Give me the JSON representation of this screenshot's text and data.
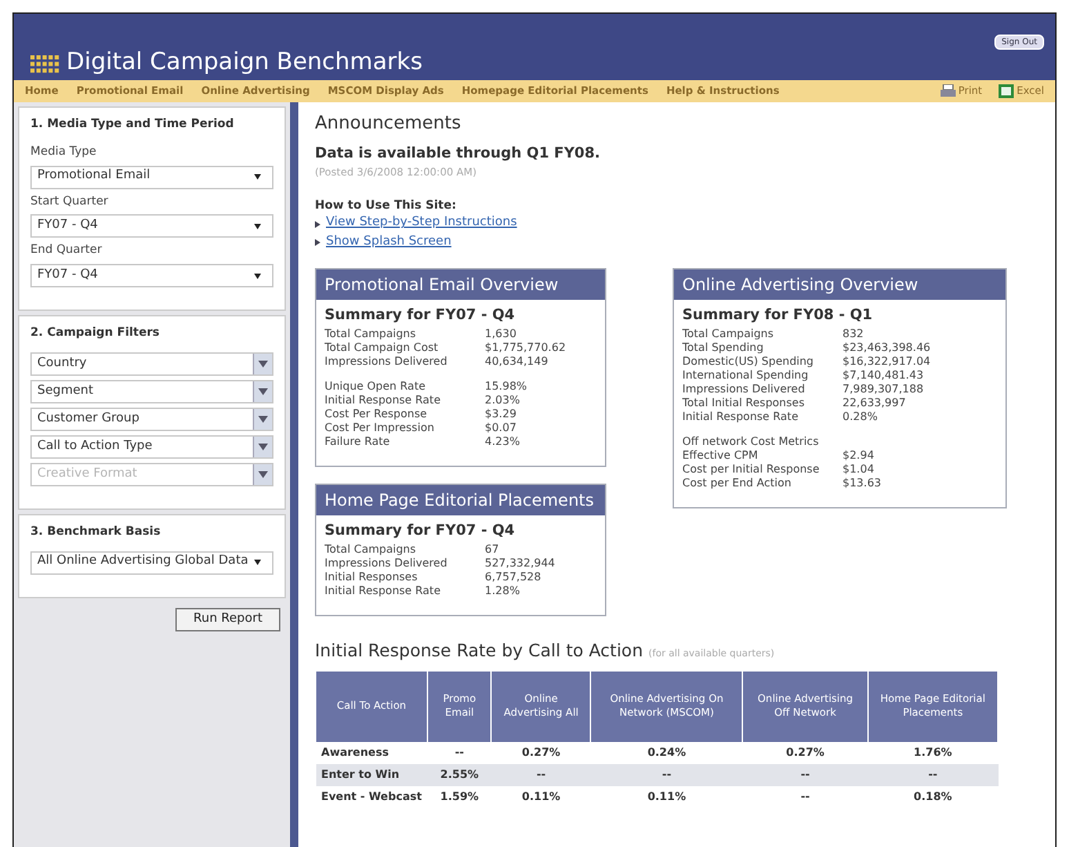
{
  "header": {
    "title": "Digital Campaign Benchmarks",
    "sign_out": "Sign Out"
  },
  "nav": {
    "items": [
      "Home",
      "Promotional Email",
      "Online Advertising",
      "MSCOM Display Ads",
      "Homepage Editorial Placements",
      "Help & Instructions"
    ],
    "actions": [
      {
        "label": "Print",
        "kind": "print"
      },
      {
        "label": "Excel",
        "kind": "excel"
      }
    ]
  },
  "sidebar": {
    "sections": [
      {
        "title": "1. Media Type and Time Period",
        "fields": [
          {
            "label": "Media Type",
            "value": "Promotional Email",
            "kind": "select",
            "disabled": false
          },
          {
            "label": "Start Quarter",
            "value": "FY07 - Q4",
            "kind": "select",
            "disabled": false
          },
          {
            "label": "End Quarter",
            "value": "FY07 - Q4",
            "kind": "select",
            "disabled": false
          }
        ]
      },
      {
        "title": "2. Campaign Filters",
        "fields": [
          {
            "value": "Country",
            "kind": "combo",
            "disabled": false
          },
          {
            "value": "Segment",
            "kind": "combo",
            "disabled": false
          },
          {
            "value": "Customer Group",
            "kind": "combo",
            "disabled": false
          },
          {
            "value": "Call to Action Type",
            "kind": "combo",
            "disabled": false
          },
          {
            "value": "Creative Format",
            "kind": "combo",
            "disabled": true
          }
        ]
      },
      {
        "title": "3. Benchmark Basis",
        "fields": [
          {
            "value": "All Online Advertising Global Data",
            "kind": "select",
            "disabled": false
          }
        ]
      }
    ],
    "button": "Run Report"
  },
  "announcements": {
    "title": "Announcements",
    "message": "Data is available through Q1 FY08.",
    "posted": "(Posted 3/6/2008 12:00:00 AM)",
    "how_to": "How to Use This Site:",
    "links": [
      "View Step-by-Step Instructions",
      "Show Splash Screen"
    ]
  },
  "left_column": [
    {
      "title": "Promotional Email Overview",
      "summary": "Summary for FY07 - Q4",
      "groups": [
        [
          [
            "Total Campaigns",
            "1,630"
          ],
          [
            "Total Campaign Cost",
            "$1,775,770.62"
          ],
          [
            "Impressions Delivered",
            "40,634,149"
          ]
        ],
        [
          [
            "Unique Open Rate",
            "15.98%"
          ],
          [
            "Initial Response Rate",
            "2.03%"
          ],
          [
            "Cost Per Response",
            "$3.29"
          ],
          [
            "Cost Per Impression",
            "$0.07"
          ],
          [
            "Failure Rate",
            "4.23%"
          ]
        ]
      ]
    },
    {
      "title": "Home Page Editorial Placements",
      "summary": "Summary for FY07 - Q4",
      "groups": [
        [
          [
            "Total Campaigns",
            "67"
          ],
          [
            "Impressions Delivered",
            "527,332,944"
          ],
          [
            "Initial Responses",
            "6,757,528"
          ],
          [
            "Initial Response Rate",
            "1.28%"
          ]
        ]
      ]
    }
  ],
  "right_column": [
    {
      "title": "Online Advertising Overview",
      "summary": "Summary for FY08 - Q1",
      "groups": [
        [
          [
            "Total Campaigns",
            "832"
          ],
          [
            "Total Spending",
            "$23,463,398.46"
          ],
          [
            "Domestic(US) Spending",
            "$16,322,917.04"
          ],
          [
            "International Spending",
            "$7,140,481.43"
          ],
          [
            "Impressions Delivered",
            "7,989,307,188"
          ],
          [
            "Total Initial Responses",
            "22,633,997"
          ],
          [
            "Initial Response Rate",
            "0.28%"
          ]
        ],
        [
          [
            "Off network Cost Metrics"
          ],
          [
            "Effective CPM",
            "$2.94"
          ],
          [
            "Cost per Initial Response",
            "$1.04"
          ],
          [
            "Cost per End Action",
            "$13.63"
          ]
        ]
      ]
    }
  ],
  "table": {
    "title": "Initial Response Rate by Call to Action",
    "note": "(for all available quarters)",
    "columns": [
      "Call To Action",
      "Promo Email",
      "Online Advertising All",
      "Online Advertising On Network (MSCOM)",
      "Online Advertising Off Network",
      "Home Page Editorial Placements"
    ],
    "rows": [
      [
        "Awareness",
        "--",
        "0.27%",
        "0.24%",
        "0.27%",
        "1.76%"
      ],
      [
        "Enter to Win",
        "2.55%",
        "--",
        "--",
        "--",
        "--"
      ],
      [
        "Event - Webcast",
        "1.59%",
        "0.11%",
        "0.11%",
        "--",
        "0.18%"
      ]
    ]
  }
}
